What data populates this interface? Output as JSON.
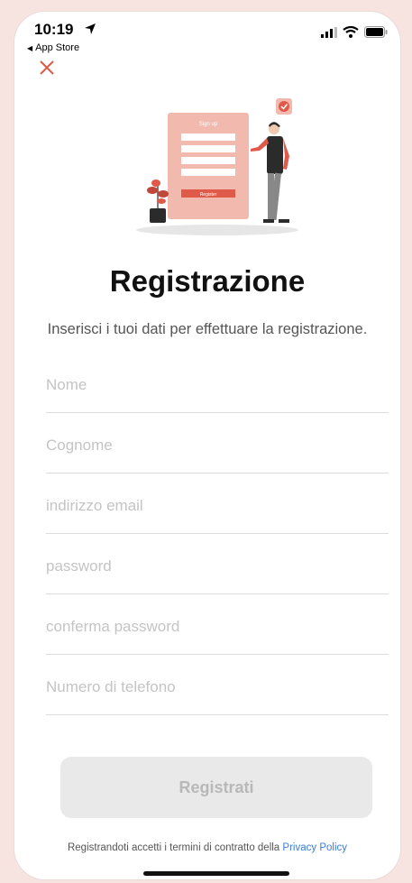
{
  "status_bar": {
    "time": "10:19",
    "back_app": "App Store"
  },
  "header": {
    "close_icon": "close-icon"
  },
  "main": {
    "illustration": {
      "form_header": "Sign up",
      "register_label": "Register"
    },
    "title": "Registrazione",
    "subtitle": "Inserisci i tuoi dati per effettuare la registrazione.",
    "fields": [
      {
        "placeholder": "Nome",
        "value": ""
      },
      {
        "placeholder": "Cognome",
        "value": ""
      },
      {
        "placeholder": "indirizzo email",
        "value": ""
      },
      {
        "placeholder": "password",
        "value": ""
      },
      {
        "placeholder": "conferma password",
        "value": ""
      },
      {
        "placeholder": "Numero di telefono",
        "value": ""
      }
    ],
    "submit_label": "Registrati",
    "terms_text": "Registrandoti accetti i termini di contratto della",
    "terms_link": "Privacy Policy"
  },
  "colors": {
    "accent": "#e05a4a",
    "link": "#3b7ddd",
    "button_bg": "#e9e9e9"
  }
}
